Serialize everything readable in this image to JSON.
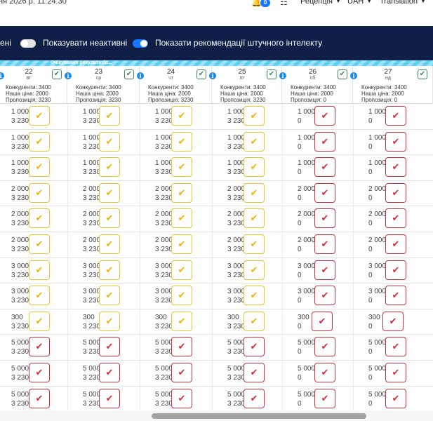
{
  "topbar": {
    "datetime": "ня 2026 р. 11:24:30",
    "notifications": "0",
    "reception": "Рецепція",
    "currency": "UAH",
    "translation": "Translation"
  },
  "filters": {
    "partial_label": "ені",
    "show_inactive": "Показувати неактивні",
    "show_inactive_on": false,
    "show_ai": "Показати рекомендації штучного інтелекту",
    "show_ai_on": true
  },
  "banner": "Очікування результатів...",
  "columns": [
    {
      "day": "22",
      "weekday": "вт",
      "competitors": "Конкуренти: 3400",
      "our_price": "Наша ціна: 2000",
      "proposal": "Пропозиція: 3230"
    },
    {
      "day": "23",
      "weekday": "ср",
      "competitors": "Конкуренти: 3400",
      "our_price": "Наша ціна: 2000",
      "proposal": "Пропозиція: 3230"
    },
    {
      "day": "24",
      "weekday": "чт",
      "competitors": "Конкуренти: 3400",
      "our_price": "Наша ціна: 2000",
      "proposal": "Пропозиція: 3230"
    },
    {
      "day": "25",
      "weekday": "пт",
      "competitors": "Конкуренти: 3400",
      "our_price": "Наша ціна: 2000",
      "proposal": "Пропозиція: 3230"
    },
    {
      "day": "26",
      "weekday": "сб",
      "competitors": "Конкуренти: 3400",
      "our_price": "Наша ціна: 2000",
      "proposal": "Пропозиція: 0"
    },
    {
      "day": "27",
      "weekday": "нд",
      "competitors": "Конкуренти: 3400",
      "our_price": "Наша ціна: 2000",
      "proposal": "Пропозиція: 0"
    }
  ],
  "rows": [
    {
      "current": "1 000",
      "w": "3 230",
      "we": "0",
      "w_status": "ok",
      "we_status": "bad"
    },
    {
      "current": "1 000",
      "w": "3 230",
      "we": "0",
      "w_status": "ok",
      "we_status": "bad"
    },
    {
      "current": "1 000",
      "w": "3 230",
      "we": "0",
      "w_status": "ok",
      "we_status": "bad"
    },
    {
      "current": "2 000",
      "w": "3 230",
      "we": "0",
      "w_status": "ok",
      "we_status": "bad"
    },
    {
      "current": "2 000",
      "w": "3 230",
      "we": "0",
      "w_status": "ok",
      "we_status": "bad"
    },
    {
      "current": "2 000",
      "w": "3 230",
      "we": "0",
      "w_status": "ok",
      "we_status": "bad"
    },
    {
      "current": "3 000",
      "w": "3 230",
      "we": "0",
      "w_status": "ok",
      "we_status": "bad"
    },
    {
      "current": "3 000",
      "w": "3 230",
      "we": "0",
      "w_status": "ok",
      "we_status": "bad"
    },
    {
      "current": "300",
      "w": "3 230",
      "we": "0",
      "w_status": "ok",
      "we_status": "bad"
    },
    {
      "current": "5 000",
      "w": "3 230",
      "we": "0",
      "w_status": "bad",
      "we_status": "bad"
    },
    {
      "current": "5 000",
      "w": "3 230",
      "we": "0",
      "w_status": "bad",
      "we_status": "bad"
    },
    {
      "current": "5 000",
      "w": "3 230",
      "we": "0",
      "w_status": "bad",
      "we_status": "bad"
    }
  ],
  "icons": {
    "check": "check-icon",
    "info": "info-icon",
    "bell": "bell-icon",
    "network": "network-icon"
  },
  "colors": {
    "navy": "#0f1f47",
    "accent": "#1677ff",
    "ok": "#f0c22e",
    "bad": "#d32f3a",
    "header_check": "#3a8a5a",
    "stripe": "#5cd0f5"
  }
}
